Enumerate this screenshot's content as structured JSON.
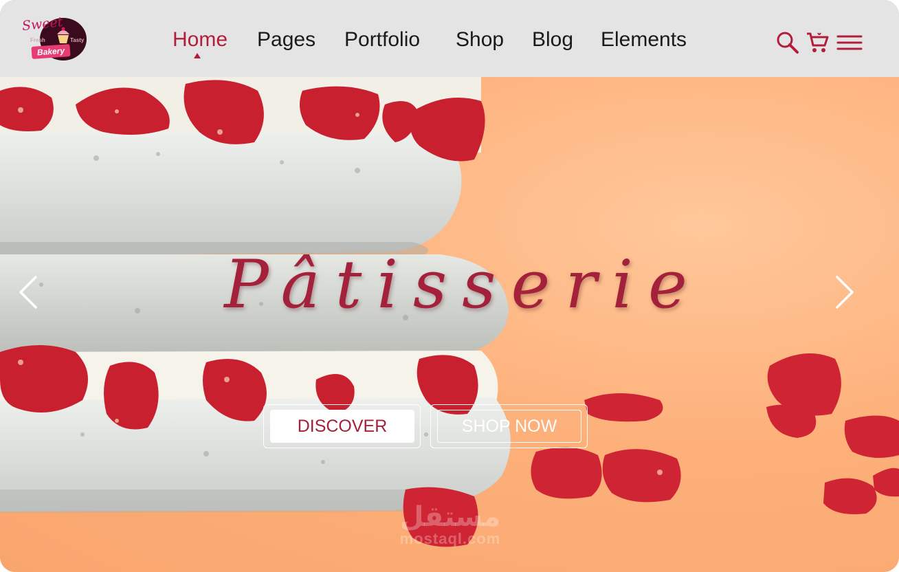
{
  "brand": {
    "script": "Sweet",
    "left_tag": "Fresh",
    "right_tag": "Tasty",
    "name": "Bakery"
  },
  "nav": {
    "items": [
      {
        "label": "Home",
        "active": true
      },
      {
        "label": "Pages",
        "active": false
      },
      {
        "label": "Portfolio",
        "active": false
      },
      {
        "label": "Shop",
        "active": false
      },
      {
        "label": "Blog",
        "active": false
      },
      {
        "label": "Elements",
        "active": false
      }
    ]
  },
  "header_icons": [
    "search-icon",
    "cart-icon",
    "hamburger-menu-icon"
  ],
  "hero": {
    "title": "Pâtisserie",
    "primary_button": "DISCOVER",
    "secondary_button": "SHOP NOW",
    "prev_icon": "chevron-left-icon",
    "next_icon": "chevron-right-icon"
  },
  "watermark": {
    "arabic": "مستقل",
    "latin": "mostaql.com"
  },
  "colors": {
    "accent": "#b21e3a",
    "header_bg": "#e4e4e4",
    "hero_bg": "#fbb27a",
    "title": "#a3213a"
  }
}
